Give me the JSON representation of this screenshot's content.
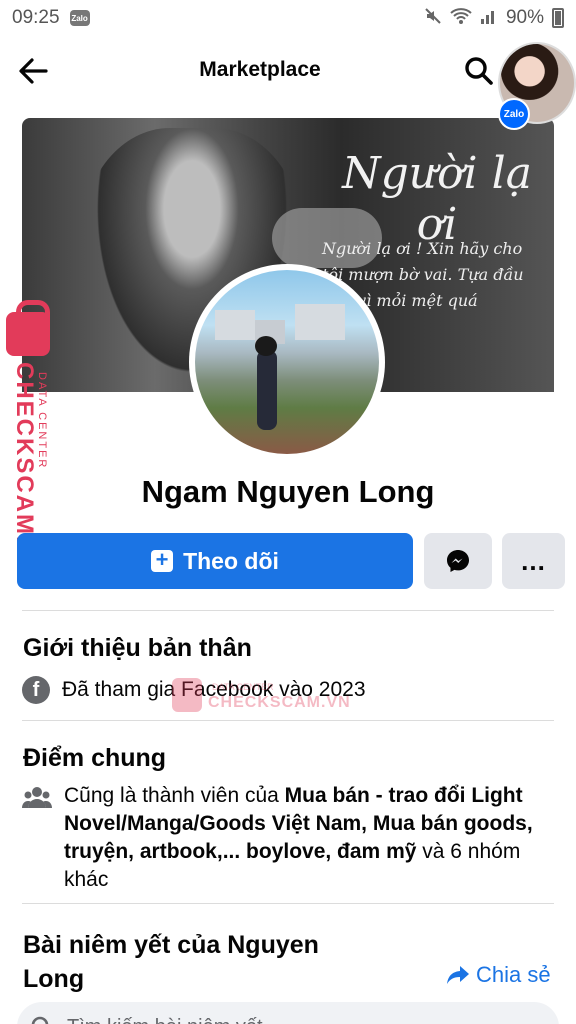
{
  "status_bar": {
    "time": "09:25",
    "left_app_icon": "Zalo",
    "battery": "90%"
  },
  "header": {
    "title": "Marketplace"
  },
  "chat_bubble": {
    "badge": "Zalo"
  },
  "cover": {
    "title": "Người lạ ơi",
    "lines": [
      "Người lạ ơi ! Xin hãy cho",
      "tôi mượn bờ vai. Tựa đầu",
      "ngã vì mỏi mệt quá"
    ]
  },
  "watermark": {
    "brand": "CHECKSCAM.VN",
    "sub": "DATA CENTER"
  },
  "profile": {
    "name": "Ngam Nguyen Long"
  },
  "actions": {
    "follow_label": "Theo dõi",
    "more_label": "..."
  },
  "about": {
    "title": "Giới thiệu bản thân",
    "joined": "Đã tham gia Facebook vào 2023"
  },
  "common": {
    "title": "Điểm chung",
    "prefix": "Cũng là thành viên của ",
    "groups": "Mua bán - trao đổi Light Novel/Manga/Goods Việt Nam, Mua bán goods, truyện, artbook,... boylove, đam mỹ",
    "suffix": " và 6 nhóm khác"
  },
  "listings": {
    "title": "Bài niêm yết của Nguyen Long",
    "share_label": "Chia sẻ",
    "search_placeholder": "Tìm kiếm bài niêm yết"
  },
  "colors": {
    "primary": "#1b74e4",
    "watermark": "#e23b5a",
    "button_gray": "#e4e6eb"
  }
}
